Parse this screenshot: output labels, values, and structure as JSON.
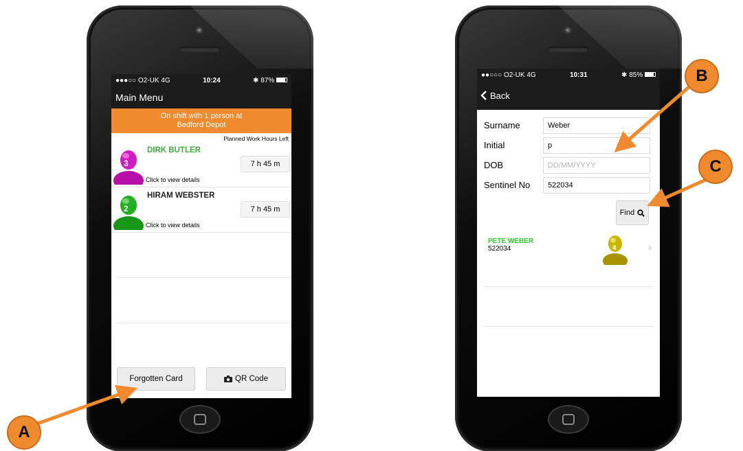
{
  "left_phone": {
    "status": {
      "carrier": "●●●○○ O2-UK  4G",
      "time": "10:24",
      "battery": "87%"
    },
    "nav_title": "Main Menu",
    "shift_banner": {
      "line1": "On shift with 1 person at",
      "line2": "Bedford Depot"
    },
    "hours_header": "Planned Work Hours Left",
    "people": [
      {
        "name": "DIRK BUTLER",
        "name_color": "#3fae3f",
        "hours": "7 h 45 m",
        "details": "Click to view details",
        "avatar_number": "3",
        "avatar_color": "#d11cc4"
      },
      {
        "name": "HIRAM WEBSTER",
        "name_color": "#222222",
        "hours": "7 h 45 m",
        "details": "Click to view details",
        "avatar_number": "2",
        "avatar_color": "#22b022"
      }
    ],
    "buttons": {
      "forgotten": "Forgotten Card",
      "qr": "QR Code"
    }
  },
  "right_phone": {
    "status": {
      "carrier": "●●○○○ O2-UK  4G",
      "time": "10:31",
      "battery": "85%"
    },
    "back_label": "Back",
    "form": {
      "surname_label": "Surname",
      "surname_value": "Weber",
      "initial_label": "Initial",
      "initial_value": "p",
      "dob_label": "DOB",
      "dob_placeholder": "DD/MM/YYYY",
      "sentinel_label": "Sentinel No",
      "sentinel_value": "522034"
    },
    "find_label": "Find",
    "result": {
      "name": "PETE WEBER",
      "number": "522034",
      "avatar_number": "4",
      "avatar_color": "#c9b600"
    }
  },
  "callouts": {
    "a": "A",
    "b": "B",
    "c": "C"
  },
  "accent_color": "#f08a2e"
}
